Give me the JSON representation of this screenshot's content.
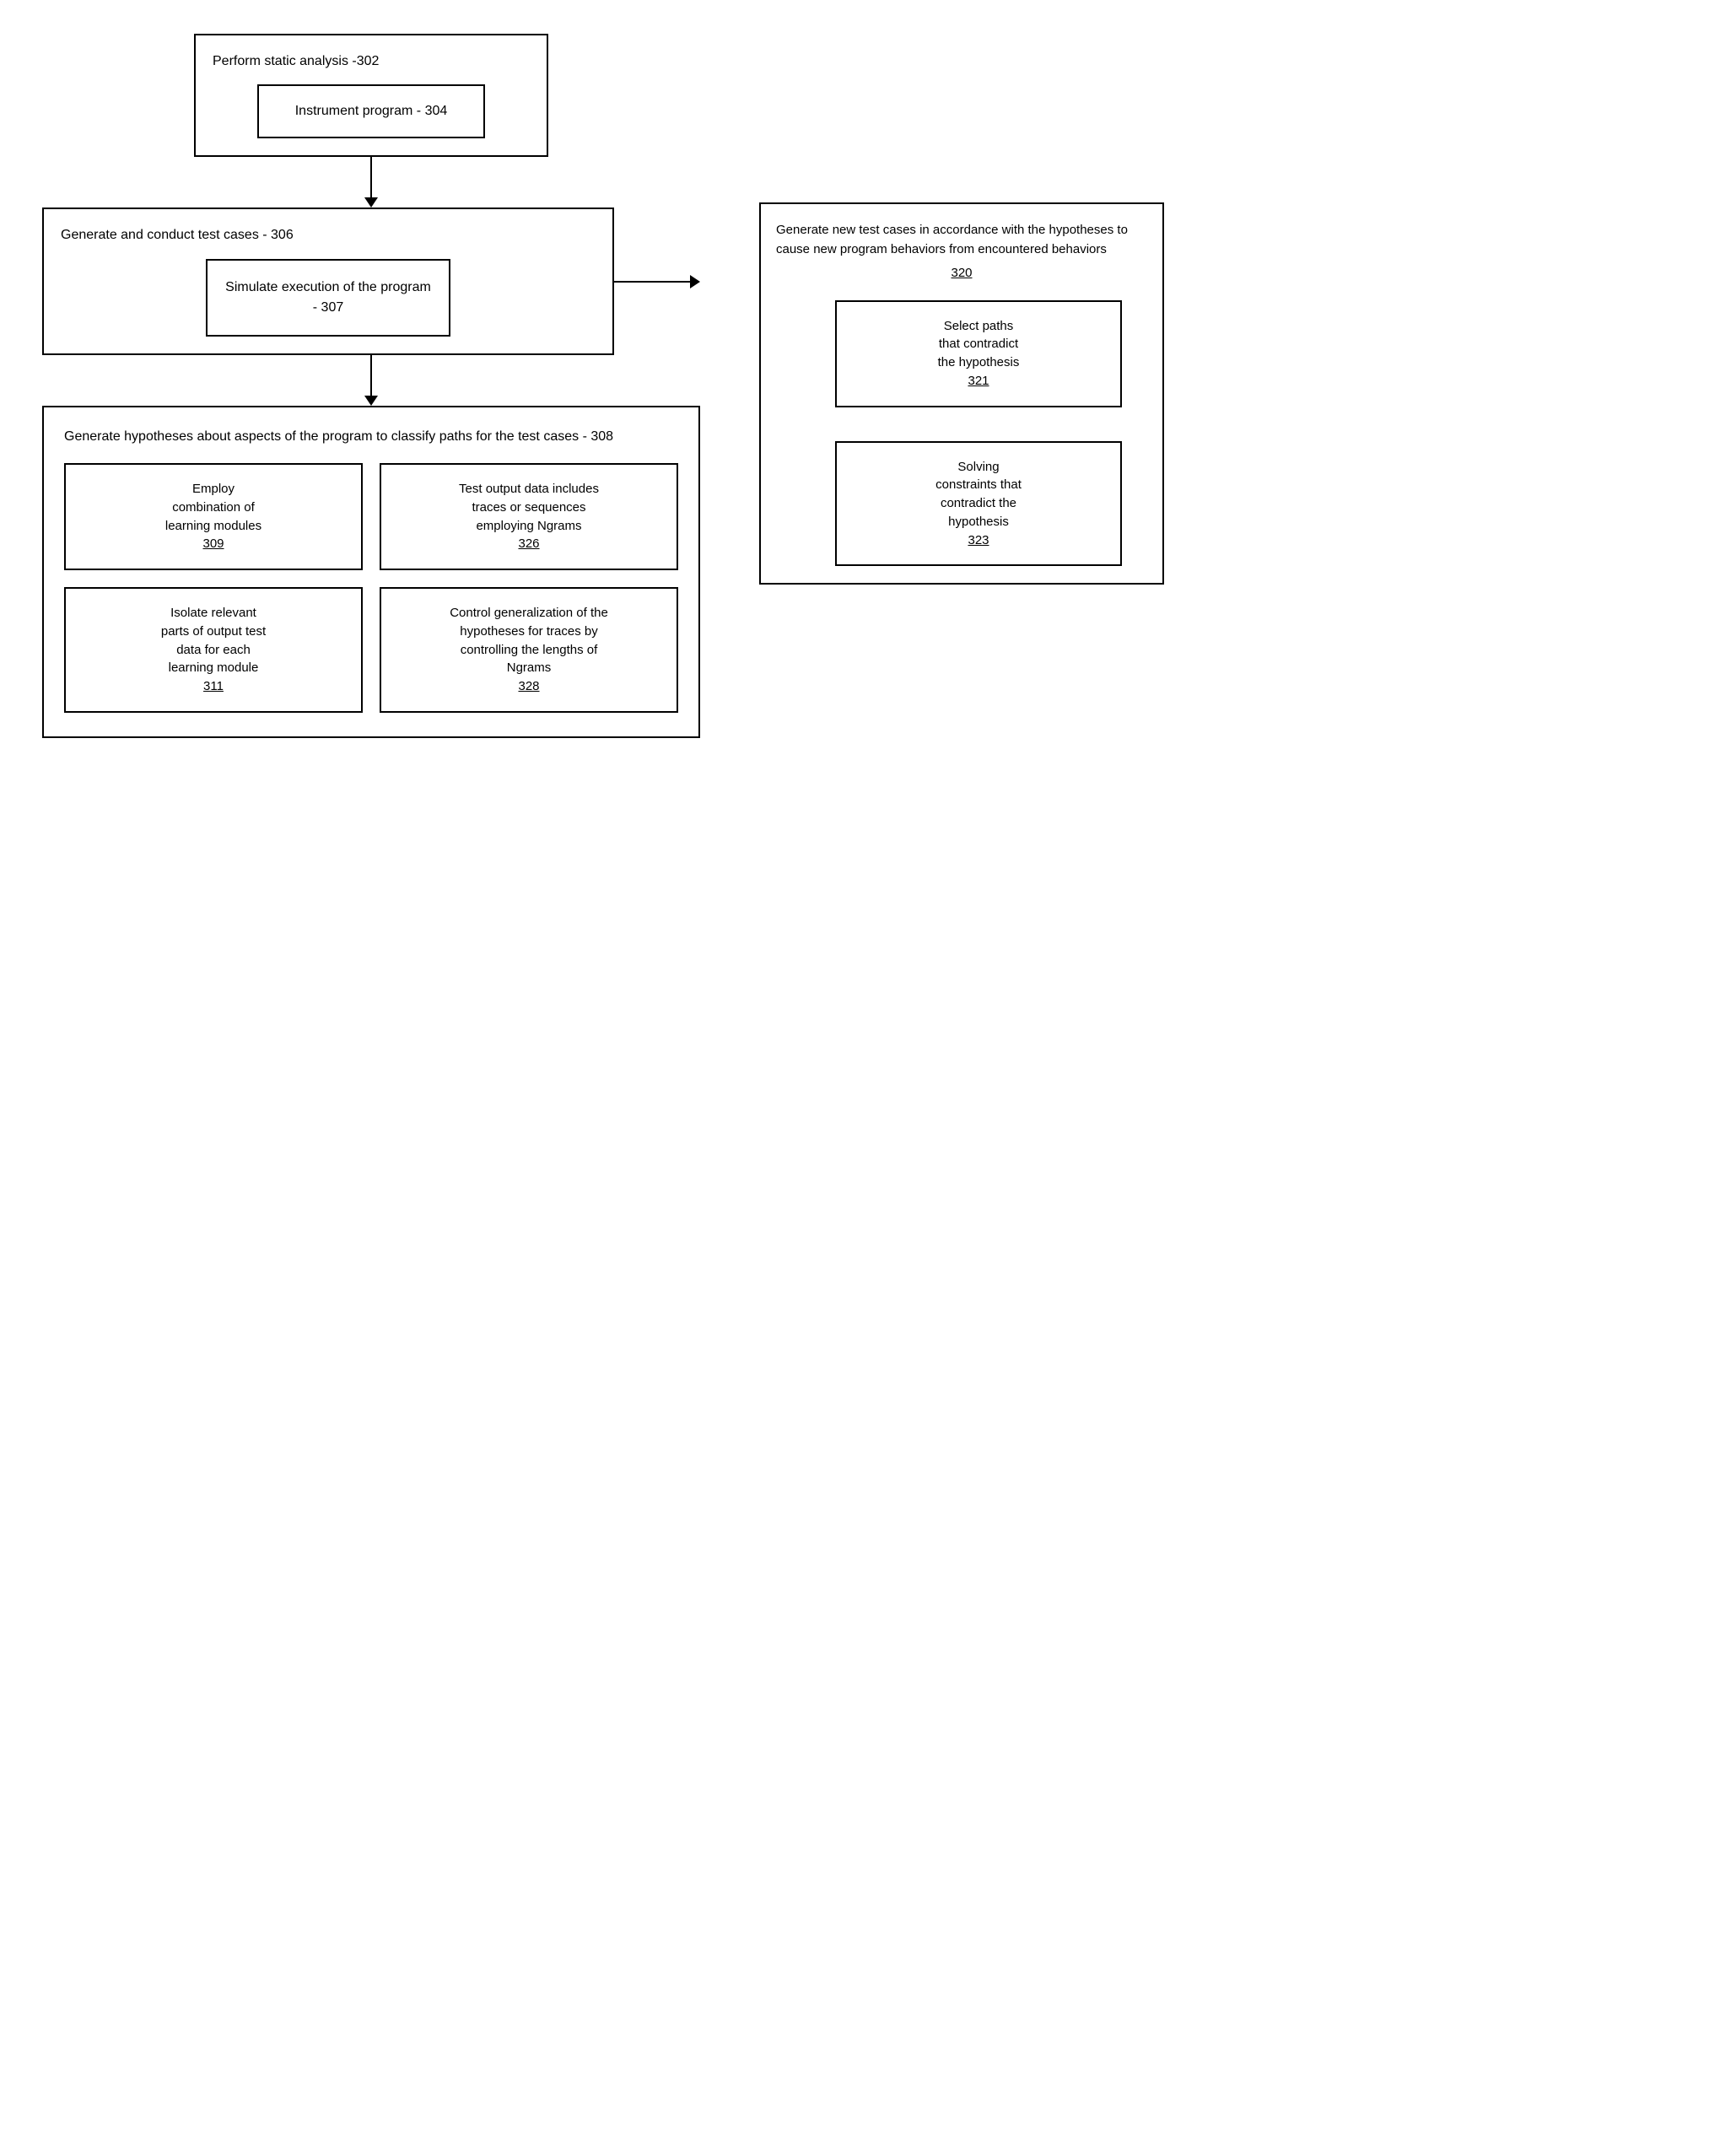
{
  "diagram": {
    "box302": {
      "title": "Perform static analysis -302",
      "inner304": {
        "label": "Instrument program - 304"
      }
    },
    "box306": {
      "title": "Generate and conduct test cases - 306",
      "inner307": {
        "label": "Simulate execution of the program - 307"
      }
    },
    "box308": {
      "title": "Generate hypotheses about aspects of the program to classify paths for the test cases - 308",
      "grid": [
        {
          "label": "Employ combination of learning modules",
          "number": "309"
        },
        {
          "label": "Test output data includes traces or sequences employing Ngrams",
          "number": "326"
        },
        {
          "label": "Isolate relevant parts of output test data for each learning module",
          "number": "311"
        },
        {
          "label": "Control generalization of the hypotheses for traces by controlling the lengths of Ngrams",
          "number": "328"
        }
      ]
    },
    "right": {
      "box320": {
        "label": "Generate new test cases in accordance with the hypotheses to cause new program behaviors from encountered behaviors",
        "number": "320"
      },
      "box321": {
        "label": "Select paths that contradict the hypothesis",
        "number": "321"
      },
      "box323": {
        "label": "Solving constraints that contradict the hypothesis",
        "number": "323"
      }
    },
    "arrows": {
      "down_label": "↓"
    }
  }
}
